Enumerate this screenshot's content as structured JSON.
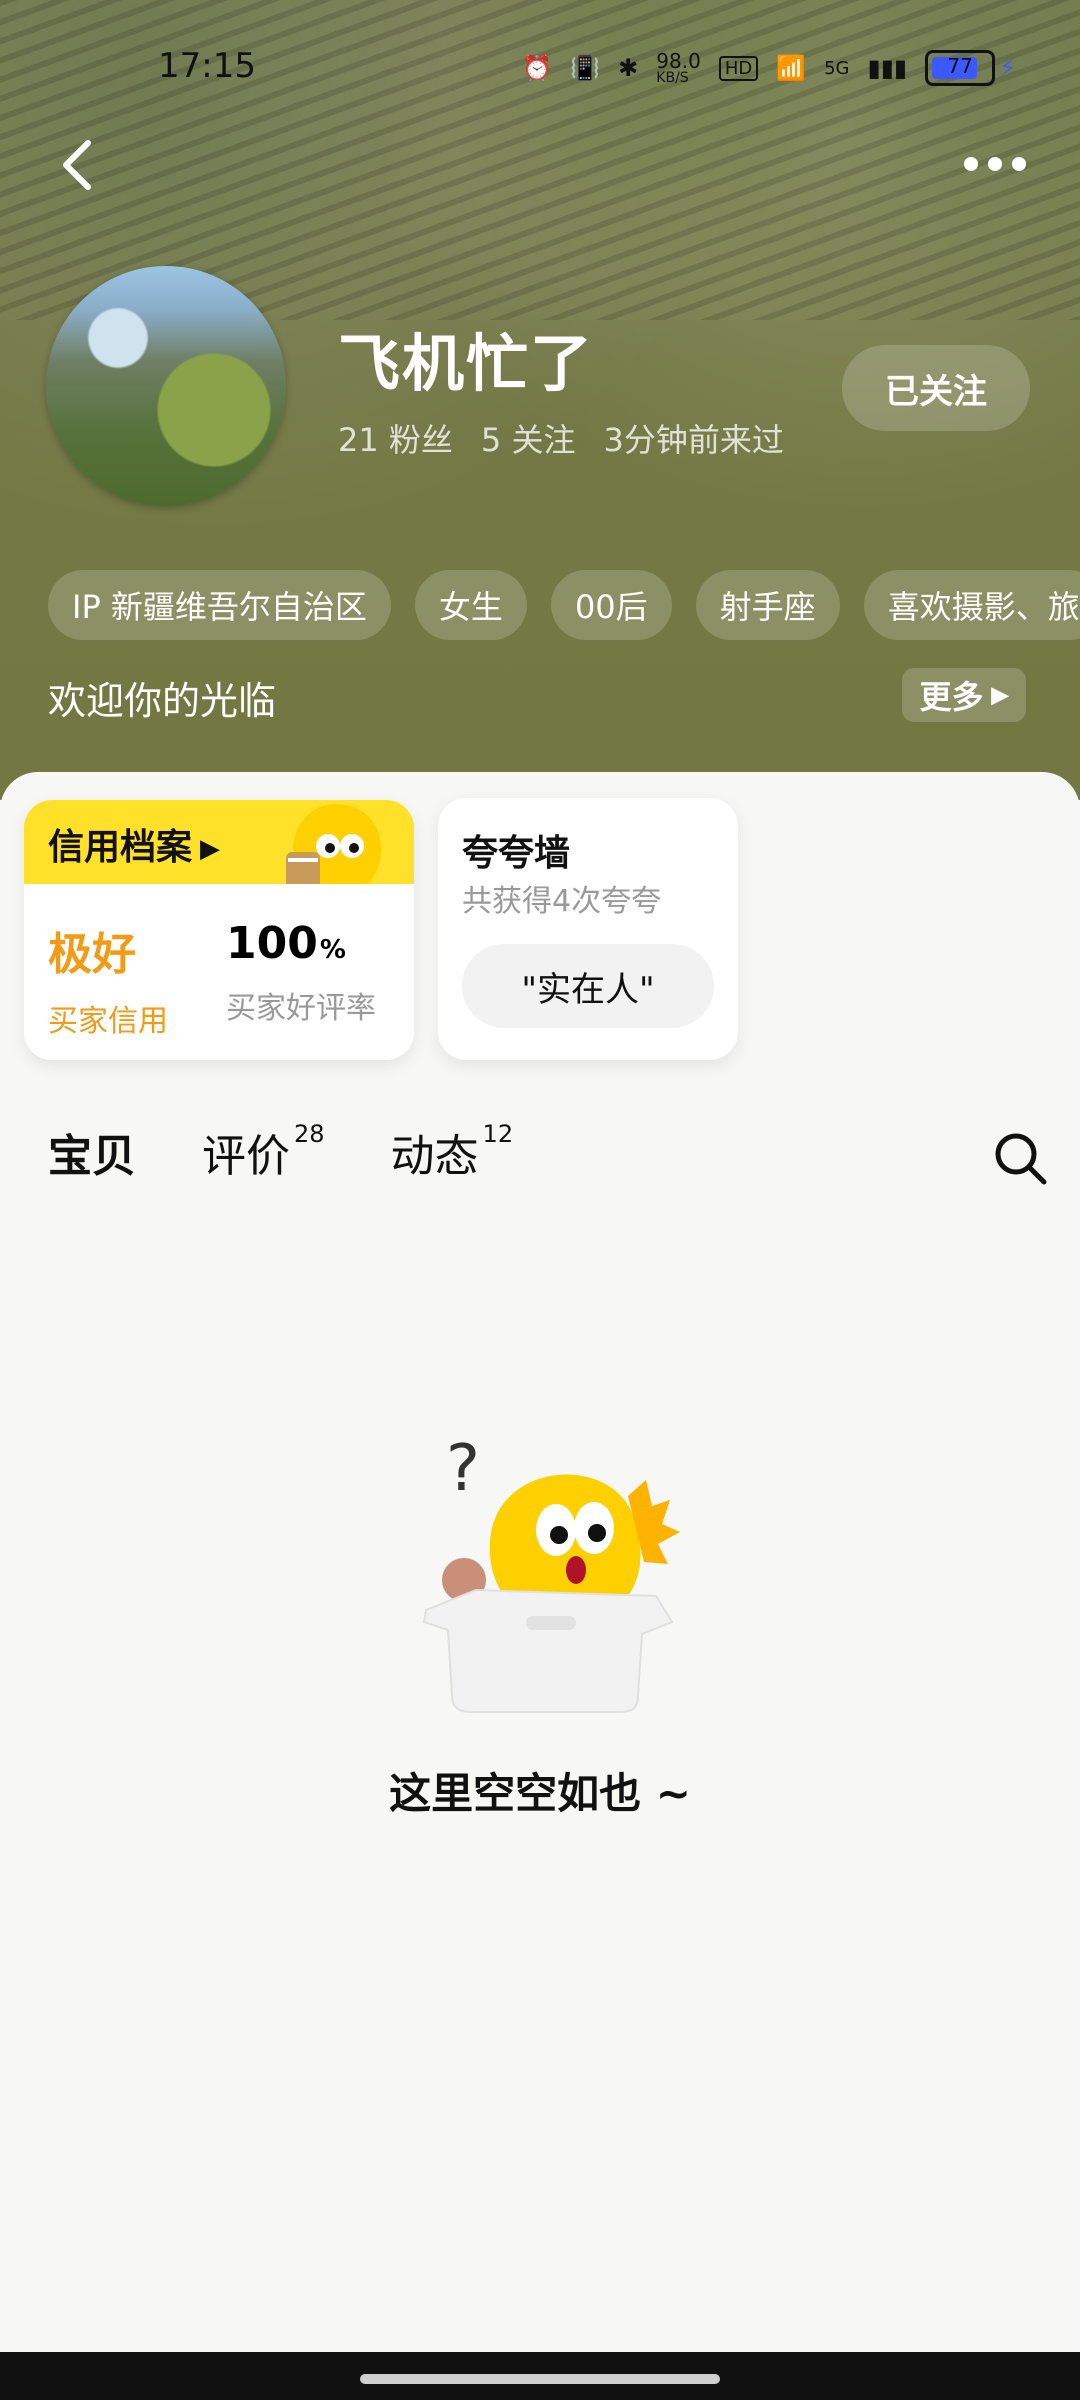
{
  "status_bar": {
    "time": "17:15",
    "network_speed": "98.0",
    "network_unit": "KB/S",
    "battery_level": "77",
    "icons": [
      "alarm-icon",
      "vibrate-icon",
      "bluetooth-icon",
      "hd-icon",
      "wifi-icon",
      "5g-icon",
      "signal-icon",
      "battery-icon",
      "charging-icon"
    ]
  },
  "header": {
    "back_icon": "chevron-left-icon",
    "more_icon": "more-dots-icon"
  },
  "profile": {
    "name": "飞机忙了",
    "followers": "21 粉丝",
    "following": "5 关注",
    "last_seen": "3分钟前来过",
    "follow_button": "已关注",
    "tags": [
      "IP 新疆维吾尔自治区",
      "女生",
      "00后",
      "射手座",
      "喜欢摄影、旅"
    ],
    "welcome_text": "欢迎你的光临",
    "more_button": "更多"
  },
  "credit_card": {
    "title": "信用档案",
    "left_value": "极好",
    "left_label": "买家信用",
    "right_value": "100",
    "right_unit": "%",
    "right_label": "买家好评率"
  },
  "praise_card": {
    "title": "夸夸墙",
    "subtitle": "共获得4次夸夸",
    "chip": "\"实在人\""
  },
  "tabs": [
    {
      "label": "宝贝",
      "count": ""
    },
    {
      "label": "评价",
      "count": "28"
    },
    {
      "label": "动态",
      "count": "12"
    }
  ],
  "empty_state": {
    "text": "这里空空如也 ~"
  },
  "colors": {
    "accent_yellow": "#ffe12a",
    "orange_text": "#f39a16",
    "hero_bg": "#737843"
  }
}
